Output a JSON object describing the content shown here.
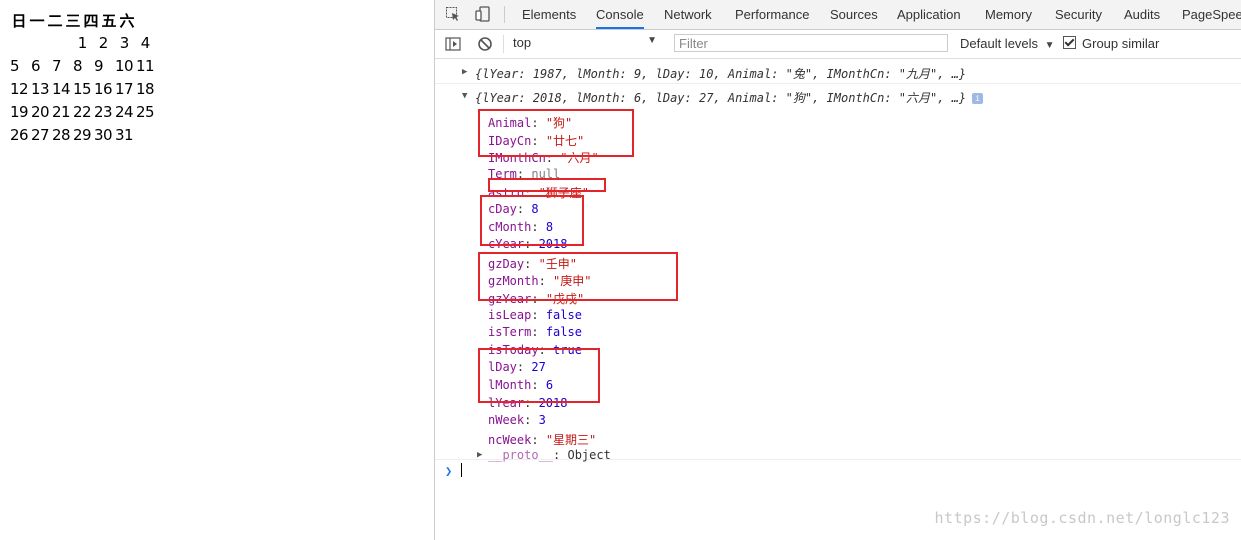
{
  "calendar": {
    "weekdays": [
      "日",
      "一",
      "二",
      "三",
      "四",
      "五",
      "六"
    ],
    "rows": [
      [
        "",
        "",
        "",
        "1",
        "2",
        "3",
        "4"
      ],
      [
        "5",
        "6",
        "7",
        "8",
        "9",
        "10",
        "11"
      ],
      [
        "12",
        "13",
        "14",
        "15",
        "16",
        "17",
        "18"
      ],
      [
        "19",
        "20",
        "21",
        "22",
        "23",
        "24",
        "25"
      ],
      [
        "26",
        "27",
        "28",
        "29",
        "30",
        "31",
        ""
      ]
    ]
  },
  "devtools": {
    "tabs": [
      "Elements",
      "Console",
      "Network",
      "Performance",
      "Sources",
      "Application",
      "Memory",
      "Security",
      "Audits",
      "PageSpeed"
    ],
    "active_tab": "Console",
    "context": "top",
    "filter_placeholder": "Filter",
    "levels_label": "Default levels",
    "group_similar_label": "Group similar",
    "group_similar_checked": true,
    "messages": [
      {
        "collapsed": true,
        "preview": "{lYear: 1987, lMonth: 9, lDay: 10, Animal: \"兔\", IMonthCn: \"九月\", …}"
      },
      {
        "collapsed": false,
        "preview": "{lYear: 2018, lMonth: 6, lDay: 27, Animal: \"狗\", IMonthCn: \"六月\", …}",
        "info_badge": "i",
        "properties": [
          {
            "key": "Animal",
            "value": "\"狗\"",
            "type": "string"
          },
          {
            "key": "IDayCn",
            "value": "\"廿七\"",
            "type": "string"
          },
          {
            "key": "IMonthCn",
            "value": "\"六月\"",
            "type": "string"
          },
          {
            "key": "Term",
            "value": "null",
            "type": "null"
          },
          {
            "key": "astro",
            "value": "\"狮子座\"",
            "type": "string"
          },
          {
            "key": "cDay",
            "value": "8",
            "type": "number"
          },
          {
            "key": "cMonth",
            "value": "8",
            "type": "number"
          },
          {
            "key": "cYear",
            "value": "2018",
            "type": "number"
          },
          {
            "key": "gzDay",
            "value": "\"壬申\"",
            "type": "string"
          },
          {
            "key": "gzMonth",
            "value": "\"庚申\"",
            "type": "string"
          },
          {
            "key": "gzYear",
            "value": "\"戊戌\"",
            "type": "string"
          },
          {
            "key": "isLeap",
            "value": "false",
            "type": "number"
          },
          {
            "key": "isTerm",
            "value": "false",
            "type": "number"
          },
          {
            "key": "isToday",
            "value": "true",
            "type": "number"
          },
          {
            "key": "lDay",
            "value": "27",
            "type": "number"
          },
          {
            "key": "lMonth",
            "value": "6",
            "type": "number"
          },
          {
            "key": "lYear",
            "value": "2018",
            "type": "number"
          },
          {
            "key": "nWeek",
            "value": "3",
            "type": "number"
          },
          {
            "key": "ncWeek",
            "value": "\"星期三\"",
            "type": "string"
          },
          {
            "key": "__proto__",
            "value": "Object",
            "type": "object"
          }
        ]
      }
    ]
  },
  "watermark": "https://blog.csdn.net/longlc123",
  "colors": {
    "highlight_box": "#e3242b",
    "accent": "#1a73e8"
  }
}
